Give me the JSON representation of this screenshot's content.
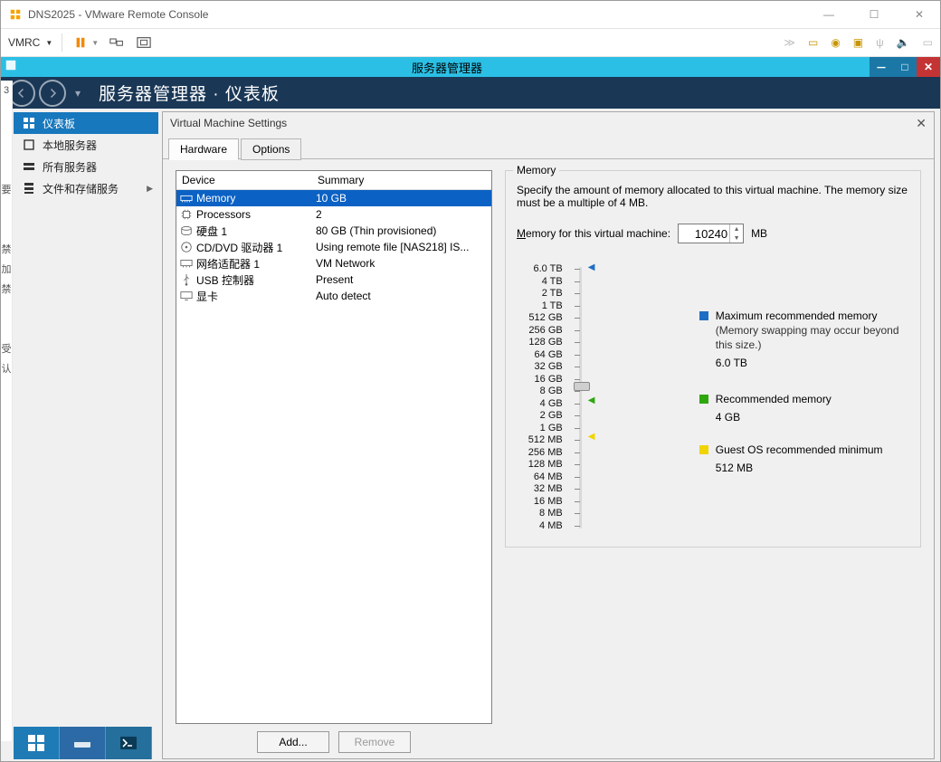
{
  "outer_window": {
    "title": "DNS2025 - VMware Remote Console",
    "vmrc_label": "VMRC"
  },
  "blue_strip": {
    "title": "服务器管理器"
  },
  "dark_header": {
    "crumbs": "服务器管理器 · 仪表板"
  },
  "sidebar": {
    "items": [
      {
        "label": "仪表板",
        "selected": true
      },
      {
        "label": "本地服务器",
        "selected": false
      },
      {
        "label": "所有服务器",
        "selected": false
      },
      {
        "label": "文件和存储服务",
        "selected": false
      }
    ]
  },
  "dialog": {
    "title": "Virtual Machine Settings",
    "tabs": {
      "hardware": "Hardware",
      "options": "Options"
    },
    "device_header": {
      "device": "Device",
      "summary": "Summary"
    },
    "devices": [
      {
        "icon": "memory",
        "label": "Memory",
        "summary": "10 GB",
        "selected": true
      },
      {
        "icon": "cpu",
        "label": "Processors",
        "summary": "2"
      },
      {
        "icon": "disk",
        "label": "硬盘 1",
        "summary": "80 GB (Thin provisioned)"
      },
      {
        "icon": "cd",
        "label": "CD/DVD 驱动器 1",
        "summary": "Using remote file [NAS218] IS..."
      },
      {
        "icon": "net",
        "label": "网络适配器 1",
        "summary": "VM Network"
      },
      {
        "icon": "usb",
        "label": "USB 控制器",
        "summary": "Present"
      },
      {
        "icon": "display",
        "label": "显卡",
        "summary": "Auto detect"
      }
    ],
    "add_btn": "Add...",
    "remove_btn": "Remove"
  },
  "memory": {
    "legend": "Memory",
    "desc": "Specify the amount of memory allocated to this virtual machine. The memory size must be a multiple of 4 MB.",
    "label": "Memory for this virtual machine:",
    "value": "10240",
    "unit": "MB",
    "ticks": [
      "6.0 TB",
      "4 TB",
      "2 TB",
      "1 TB",
      "512 GB",
      "256 GB",
      "128 GB",
      "64 GB",
      "32 GB",
      "16 GB",
      "8 GB",
      "4 GB",
      "2 GB",
      "1 GB",
      "512 MB",
      "256 MB",
      "128 MB",
      "64 MB",
      "32 MB",
      "16 MB",
      "8 MB",
      "4 MB"
    ],
    "markers": {
      "max": {
        "color": "#1d6fc4",
        "title": "Maximum recommended memory",
        "sub": "(Memory swapping may occur beyond this size.)",
        "value": "6.0 TB"
      },
      "rec": {
        "color": "#2ea70f",
        "title": "Recommended memory",
        "value": "4 GB"
      },
      "min": {
        "color": "#f0d400",
        "title": "Guest OS recommended minimum",
        "value": "512 MB"
      }
    }
  }
}
